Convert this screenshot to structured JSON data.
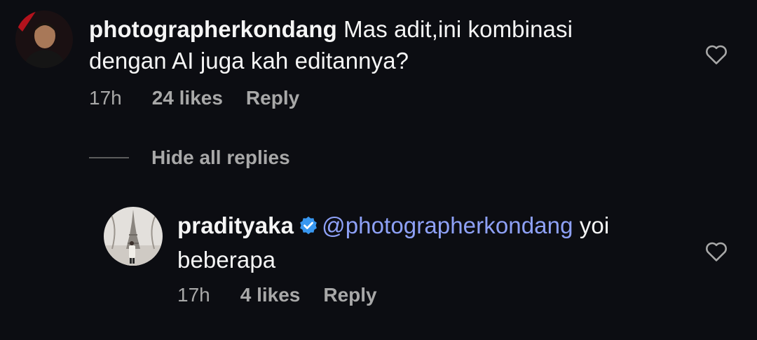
{
  "comment": {
    "avatar_icon": "user-avatar-photo",
    "username": "photographerkondang",
    "text_line1": "Mas adit,ini kombinasi",
    "text_line2": "dengan AI juga kah editannya?",
    "time": "17h",
    "likes": "24 likes",
    "reply_label": "Reply",
    "heart_icon": "heart-outline-icon"
  },
  "replies_toggle": {
    "label": "Hide all replies"
  },
  "reply": {
    "avatar_icon": "user-avatar-photo",
    "username": "pradityaka",
    "verified_icon": "verified-badge-icon",
    "mention": "@photographerkondang",
    "text_tail": " yoi",
    "text_line2": "beberapa",
    "time": "17h",
    "likes": "4 likes",
    "reply_label": "Reply",
    "heart_icon": "heart-outline-icon"
  },
  "colors": {
    "background": "#0c0d12",
    "text": "#f5f5f5",
    "muted": "#a8a8a8",
    "mention": "#8ea1f7",
    "verified": "#3897f0"
  }
}
